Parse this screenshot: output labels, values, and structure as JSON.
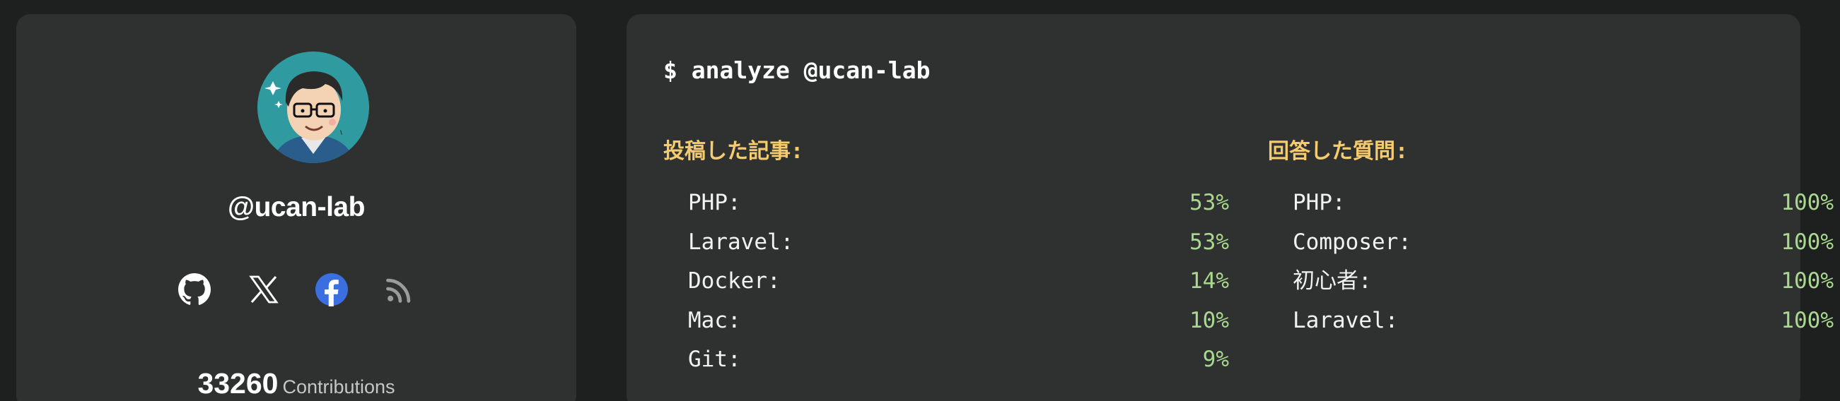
{
  "profile": {
    "username": "@ucan-lab",
    "contributions_count": "33260",
    "contributions_label": "Contributions",
    "social_icons": [
      "github-icon",
      "x-icon",
      "facebook-icon",
      "rss-icon"
    ],
    "colors": {
      "card_bg": "#2f3030",
      "page_bg": "#1e1f1f",
      "facebook_blue": "#3b6fe0",
      "avatar_bg": "#2f9ba0"
    }
  },
  "terminal": {
    "command": "$ analyze @ucan-lab",
    "articles": {
      "title": "投稿した記事:",
      "items": [
        {
          "name": "PHP:",
          "pct": "53%"
        },
        {
          "name": "Laravel:",
          "pct": "53%"
        },
        {
          "name": "Docker:",
          "pct": "14%"
        },
        {
          "name": "Mac:",
          "pct": "10%"
        },
        {
          "name": "Git:",
          "pct": "9%"
        }
      ]
    },
    "answers": {
      "title": "回答した質問:",
      "items": [
        {
          "name": "PHP:",
          "pct": "100%"
        },
        {
          "name": "Composer:",
          "pct": "100%"
        },
        {
          "name": "初心者:",
          "pct": "100%"
        },
        {
          "name": "Laravel:",
          "pct": "100%"
        }
      ]
    },
    "colors": {
      "heading": "#f4cb6e",
      "percent": "#a9d98f",
      "text": "#f2f2f2"
    }
  }
}
